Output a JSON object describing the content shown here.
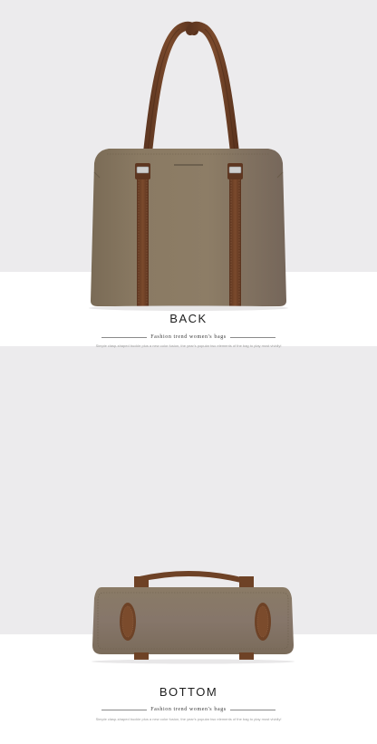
{
  "back_section": {
    "title": "BACK",
    "subtitle": "Fashion trend women's bags",
    "description": "Simple clasp-shaped buckle plus a new color fusion, the year's popular two elements of the bag to play most vividly!"
  },
  "bottom_section": {
    "title": "BOTTOM",
    "subtitle": "Fashion trend women's bags",
    "description": "Simple clasp-shaped buckle plus a new color fusion, the year's popular two elements of the bag to play most vividly!"
  },
  "colors": {
    "bag_body": "#86765f",
    "strap": "#6e4226",
    "background": "#ecebed"
  }
}
